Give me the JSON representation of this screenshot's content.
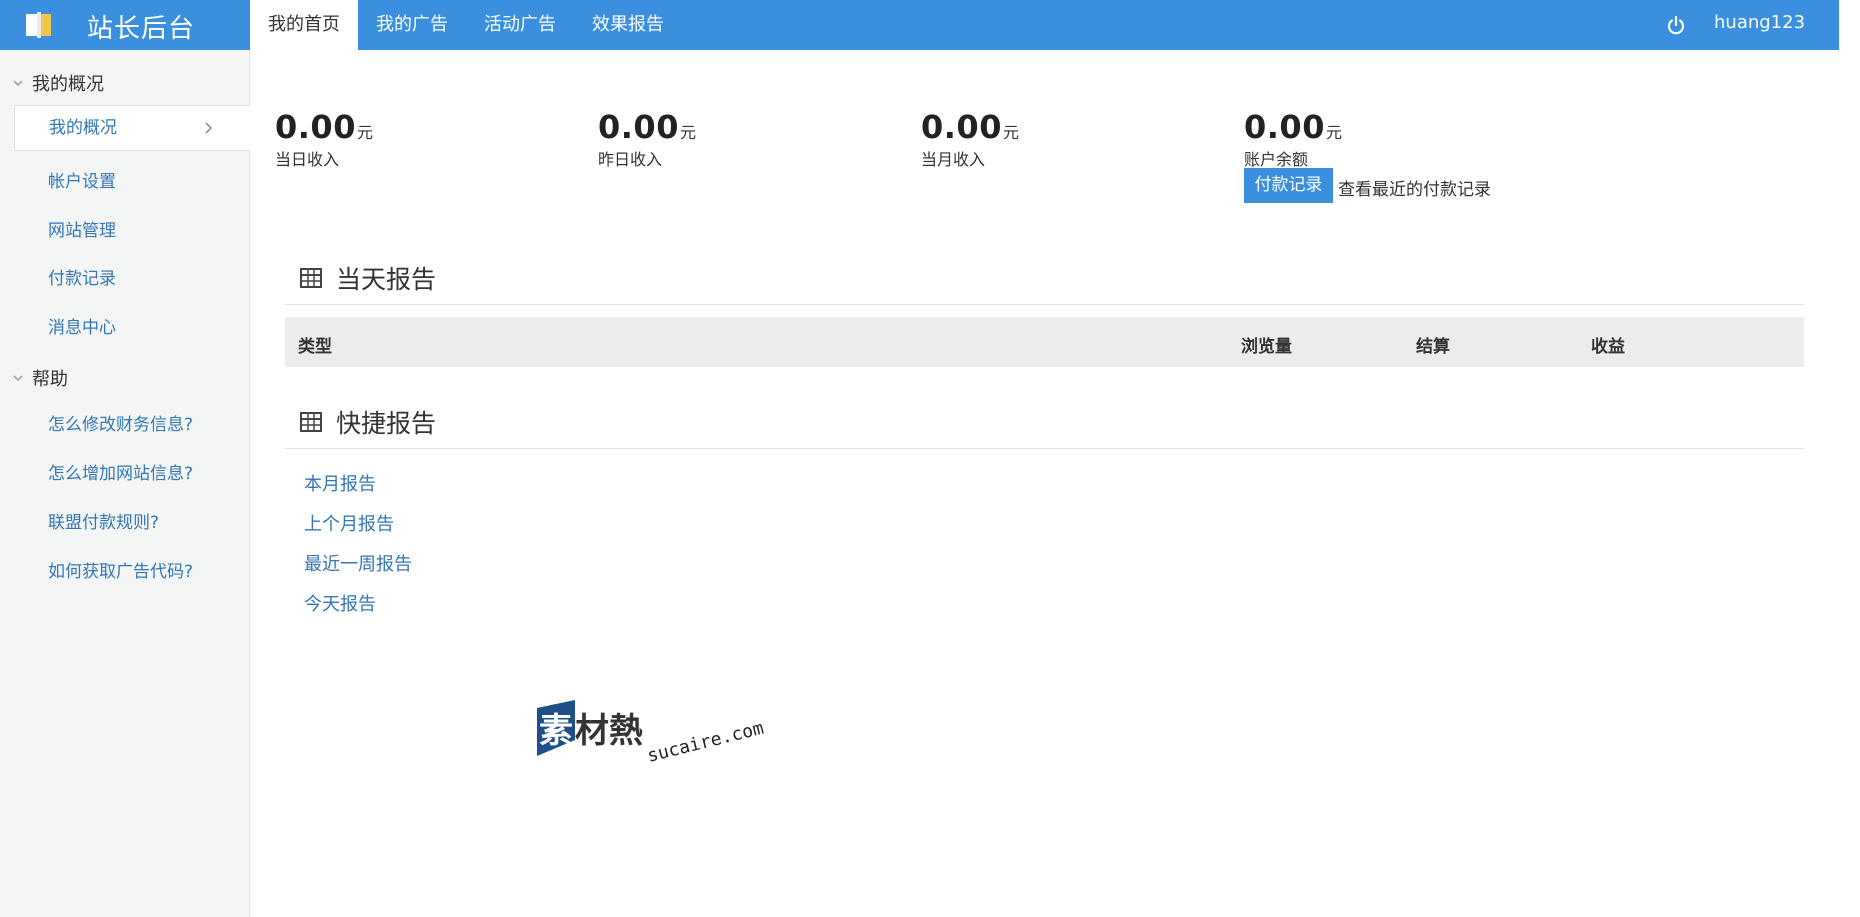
{
  "brand": {
    "title": "站长后台"
  },
  "topnav": {
    "items": [
      {
        "label": "我的首页",
        "active": true
      },
      {
        "label": "我的广告",
        "active": false
      },
      {
        "label": "活动广告",
        "active": false
      },
      {
        "label": "效果报告",
        "active": false
      }
    ],
    "username": "huang123"
  },
  "sidebar": {
    "groups": [
      {
        "label": "我的概况",
        "items": [
          {
            "label": "我的概况",
            "active": true
          },
          {
            "label": "帐户设置"
          },
          {
            "label": "网站管理"
          },
          {
            "label": "付款记录"
          },
          {
            "label": "消息中心"
          }
        ]
      },
      {
        "label": "帮助",
        "items": [
          {
            "label": "怎么修改财务信息?"
          },
          {
            "label": "怎么增加网站信息?"
          },
          {
            "label": "联盟付款规则?"
          },
          {
            "label": "如何获取广告代码?"
          }
        ]
      }
    ]
  },
  "stats": [
    {
      "value": "0.00",
      "unit": "元",
      "label": "当日收入"
    },
    {
      "value": "0.00",
      "unit": "元",
      "label": "昨日收入"
    },
    {
      "value": "0.00",
      "unit": "元",
      "label": "当月收入"
    },
    {
      "value": "0.00",
      "unit": "元",
      "label": "账户余额"
    }
  ],
  "payment": {
    "button_label": "付款记录",
    "hint": "查看最近的付款记录"
  },
  "today_report": {
    "title": "当天报告",
    "columns": [
      "类型",
      "浏览量",
      "结算",
      "收益"
    ]
  },
  "quick_report": {
    "title": "快捷报告",
    "links": [
      "本月报告",
      "上个月报告",
      "最近一周报告",
      "今天报告"
    ]
  },
  "watermark": {
    "text_cn": "素材熱",
    "text_en": "sucaire.com"
  },
  "colors": {
    "primary": "#3a8fdf",
    "link": "#3375b5",
    "sidebar_bg": "#f4f6f6",
    "table_head_bg": "#ececec"
  }
}
